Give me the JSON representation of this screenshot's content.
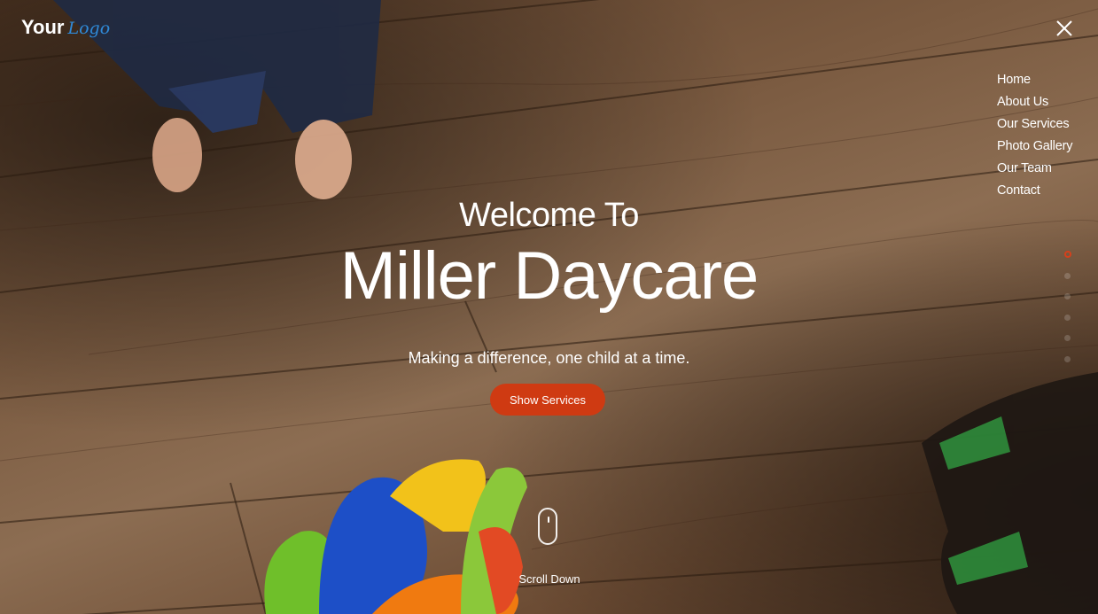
{
  "brand": {
    "logo_bold": "Your",
    "logo_script": "Logo"
  },
  "nav": {
    "items": [
      {
        "label": "Home"
      },
      {
        "label": "About Us"
      },
      {
        "label": "Our Services"
      },
      {
        "label": "Photo Gallery"
      },
      {
        "label": "Our Team"
      },
      {
        "label": "Contact"
      }
    ]
  },
  "hero": {
    "welcome": "Welcome To",
    "title": "Miller Daycare",
    "tagline": "Making a difference, one child at a time.",
    "cta_label": "Show Services",
    "scroll_label": "Scroll Down"
  },
  "pagination": {
    "count": 6,
    "active_index": 0
  },
  "colors": {
    "accent": "#cf3a12",
    "logo_script": "#2f8ad8",
    "text": "#ffffff"
  },
  "icons": {
    "close": "close-icon",
    "scroll": "mouse-icon"
  }
}
